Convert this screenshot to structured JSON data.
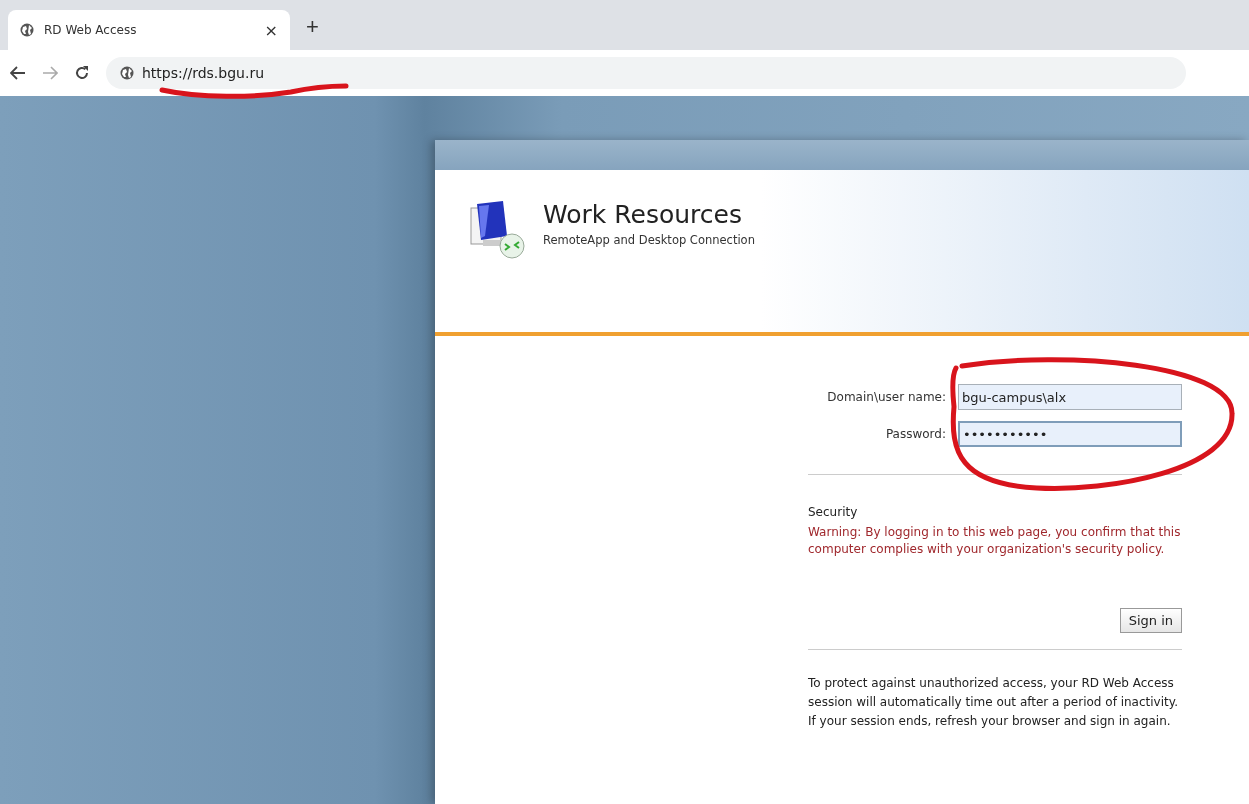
{
  "browser": {
    "tabs": [
      {
        "title": "RD Web Access",
        "close": "×",
        "selected": true
      }
    ],
    "new_tab": "+",
    "address": "https://rds.bgu.ru"
  },
  "page": {
    "title": "Work Resources",
    "subtitle": "RemoteApp and Desktop Connection",
    "fields": [
      {
        "label": "Domain\\user name:",
        "value": "bgu-campus\\alx",
        "focused": false
      },
      {
        "label": "Password:",
        "value": "•••••••••••",
        "focused": true
      }
    ],
    "security_heading": "Security",
    "warning": "Warning: By logging in to this web page, you confirm that this computer complies with your organization's security policy.",
    "sign_in": "Sign in",
    "notice": "To protect against unauthorized access, your RD Web Access session will automatically time out after a period of inactivity. If your session ends, refresh your browser and sign in again."
  },
  "annotations": [
    {
      "kind": "underline"
    },
    {
      "kind": "circle"
    }
  ]
}
